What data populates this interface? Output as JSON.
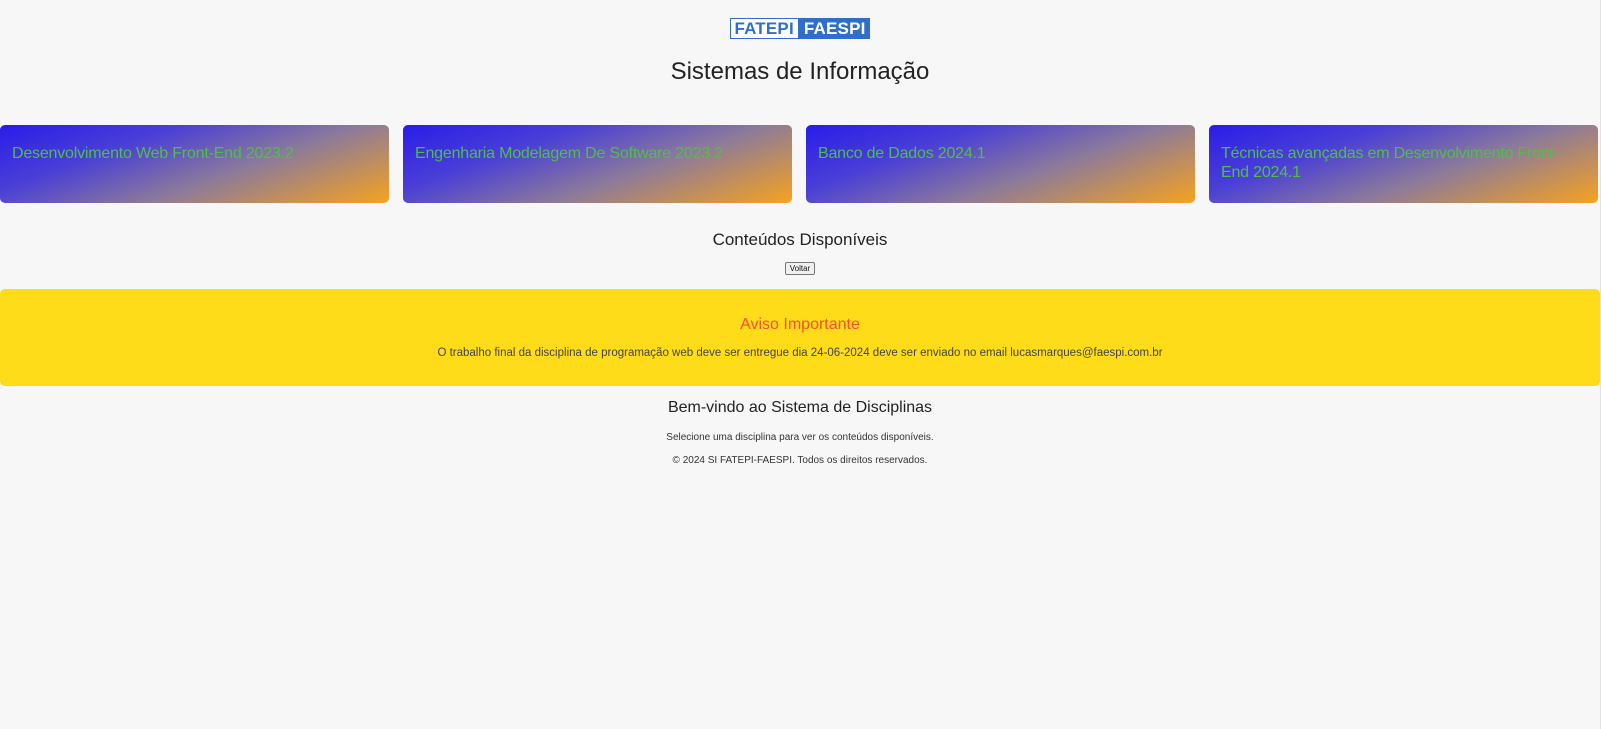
{
  "header": {
    "logo_left": "FATEPI",
    "logo_right": "FAESPI",
    "title": "Sistemas de Informação"
  },
  "courses": [
    {
      "label": "Desenvolvimento Web Front-End 2023.2"
    },
    {
      "label": "Engenharia Modelagem De Software 2023.2"
    },
    {
      "label": "Banco de Dados 2024.1"
    },
    {
      "label": "Técnicas avançadas em Desenvolvimento Front-End 2024.1"
    }
  ],
  "content": {
    "heading": "Conteúdos Disponíveis",
    "back_label": "Voltar"
  },
  "notice": {
    "title": "Aviso Importante",
    "text": "O trabalho final da disciplina de programação web deve ser entregue dia 24-06-2024 deve ser enviado no email lucasmarques@faespi.com.br"
  },
  "welcome": {
    "heading": "Bem-vindo ao Sistema de Disciplinas",
    "text": "Selecione uma disciplina para ver os conteúdos disponíveis."
  },
  "footer": {
    "text": "© 2024 SI FATEPI-FAESPI. Todos os direitos reservados."
  },
  "colors": {
    "page_bg": "#f7f7f7",
    "card_gradient_start": "#2a1de8",
    "card_gradient_end": "#f6a21f",
    "card_text": "#4fbf4a",
    "notice_bg": "#ffdc1a",
    "notice_title": "#f0522a",
    "logo_blue": "#2f6fc7"
  }
}
